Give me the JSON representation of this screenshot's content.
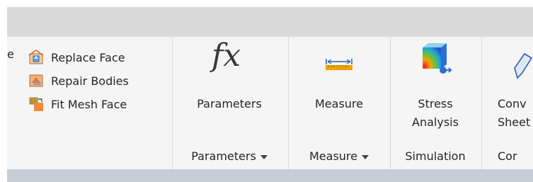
{
  "ribbon": {
    "small_commands": [
      {
        "label": "Replace Face",
        "icon": "replace-face-icon"
      },
      {
        "label": "Repair Bodies",
        "icon": "repair-bodies-icon"
      },
      {
        "label": "Fit Mesh Face",
        "icon": "fit-mesh-face-icon"
      }
    ],
    "partial_left_char": "e",
    "buttons": {
      "parameters": {
        "label": "Parameters",
        "icon": "fx-icon"
      },
      "measure": {
        "label": "Measure",
        "icon": "ruler-icon"
      },
      "stress": {
        "label_line1": "Stress",
        "label_line2": "Analysis",
        "icon": "stress-analysis-icon"
      },
      "convert": {
        "label_line1": "Conv",
        "label_line2": "Sheet",
        "icon": "convert-to-sheet-icon"
      }
    },
    "groups": {
      "parameters": "Parameters",
      "measure": "Measure",
      "simulation": "Simulation",
      "convert_partial": "Cor"
    }
  },
  "colors": {
    "ribbon_bg": "#f5f5f5",
    "top_strip": "#dadada",
    "bottom_strip": "#c6ced8"
  }
}
